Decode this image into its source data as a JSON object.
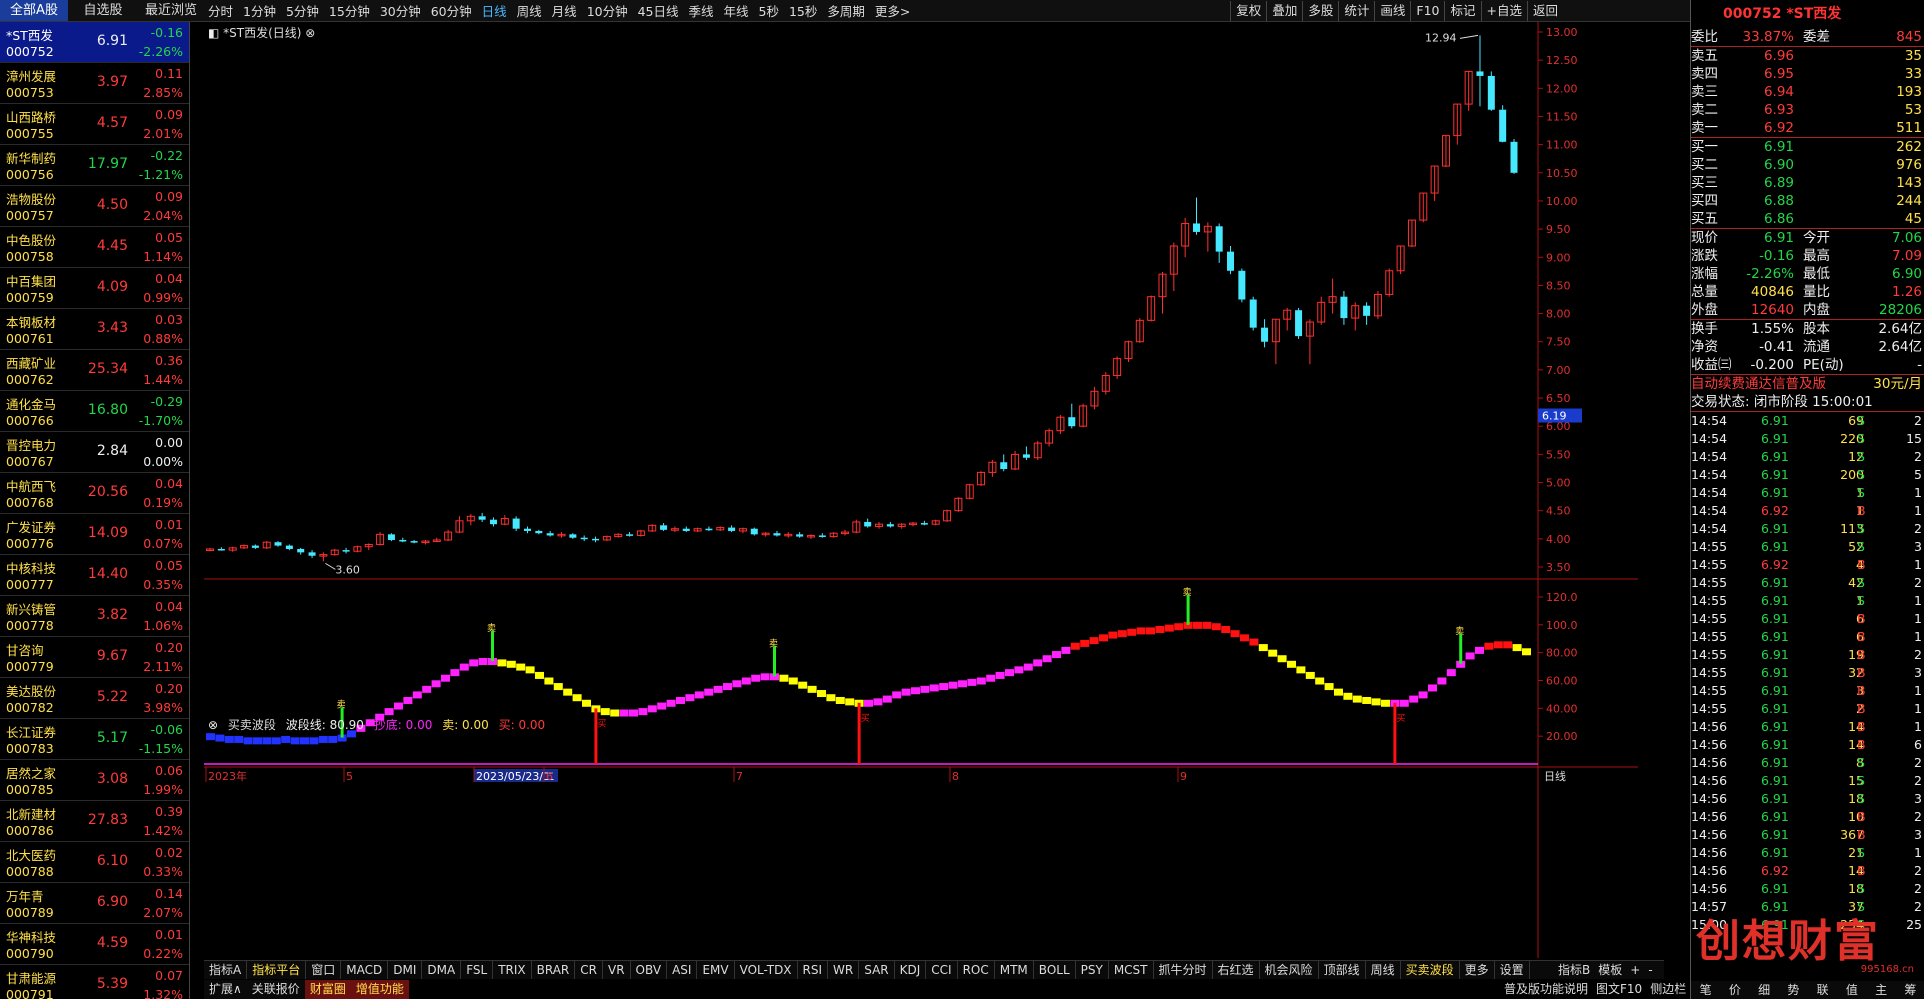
{
  "top": {
    "cats": [
      {
        "label": "全部A股",
        "x": 0,
        "w": 68,
        "active": true
      },
      {
        "label": "自选股",
        "x": 70,
        "w": 66,
        "active": false
      },
      {
        "label": "最近浏览",
        "x": 138,
        "w": 66,
        "active": false
      }
    ],
    "periods": [
      "分时",
      "1分钟",
      "5分钟",
      "15分钟",
      "30分钟",
      "60分钟",
      "日线",
      "周线",
      "月线",
      "10分钟",
      "45日线",
      "季线",
      "年线",
      "5秒",
      "15秒",
      "多周期",
      "更多>"
    ],
    "period_selected": "日线",
    "tools": [
      "复权",
      "叠加",
      "多股",
      "统计",
      "画线",
      "F10",
      "标记",
      "+自选",
      "返回"
    ]
  },
  "stocks": [
    {
      "name": "*ST西发",
      "code": "000752",
      "price": "6.91",
      "chg": "-0.16",
      "pct": "-2.26%",
      "dir": "d",
      "pc": "wht",
      "sel": true
    },
    {
      "name": "漳州发展",
      "code": "000753",
      "price": "3.97",
      "chg": "0.11",
      "pct": "2.85%",
      "dir": "u"
    },
    {
      "name": "山西路桥",
      "code": "000755",
      "price": "4.57",
      "chg": "0.09",
      "pct": "2.01%",
      "dir": "u"
    },
    {
      "name": "新华制药",
      "code": "000756",
      "price": "17.97",
      "chg": "-0.22",
      "pct": "-1.21%",
      "dir": "d"
    },
    {
      "name": "浩物股份",
      "code": "000757",
      "price": "4.50",
      "chg": "0.09",
      "pct": "2.04%",
      "dir": "u"
    },
    {
      "name": "中色股份",
      "code": "000758",
      "price": "4.45",
      "chg": "0.05",
      "pct": "1.14%",
      "dir": "u"
    },
    {
      "name": "中百集团",
      "code": "000759",
      "price": "4.09",
      "chg": "0.04",
      "pct": "0.99%",
      "dir": "u"
    },
    {
      "name": "本钢板材",
      "code": "000761",
      "price": "3.43",
      "chg": "0.03",
      "pct": "0.88%",
      "dir": "u"
    },
    {
      "name": "西藏矿业",
      "code": "000762",
      "price": "25.34",
      "chg": "0.36",
      "pct": "1.44%",
      "dir": "u"
    },
    {
      "name": "通化金马",
      "code": "000766",
      "price": "16.80",
      "chg": "-0.29",
      "pct": "-1.70%",
      "dir": "d"
    },
    {
      "name": "晋控电力",
      "code": "000767",
      "price": "2.84",
      "chg": "0.00",
      "pct": "0.00%",
      "dir": "n"
    },
    {
      "name": "中航西飞",
      "code": "000768",
      "price": "20.56",
      "chg": "0.04",
      "pct": "0.19%",
      "dir": "u"
    },
    {
      "name": "广发证券",
      "code": "000776",
      "price": "14.09",
      "chg": "0.01",
      "pct": "0.07%",
      "dir": "u"
    },
    {
      "name": "中核科技",
      "code": "000777",
      "price": "14.40",
      "chg": "0.05",
      "pct": "0.35%",
      "dir": "u"
    },
    {
      "name": "新兴铸管",
      "code": "000778",
      "price": "3.82",
      "chg": "0.04",
      "pct": "1.06%",
      "dir": "u"
    },
    {
      "name": "甘咨询",
      "code": "000779",
      "price": "9.67",
      "chg": "0.20",
      "pct": "2.11%",
      "dir": "u"
    },
    {
      "name": "美达股份",
      "code": "000782",
      "price": "5.22",
      "chg": "0.20",
      "pct": "3.98%",
      "dir": "u"
    },
    {
      "name": "长江证券",
      "code": "000783",
      "price": "5.17",
      "chg": "-0.06",
      "pct": "-1.15%",
      "dir": "d"
    },
    {
      "name": "居然之家",
      "code": "000785",
      "price": "3.08",
      "chg": "0.06",
      "pct": "1.99%",
      "dir": "u"
    },
    {
      "name": "北新建材",
      "code": "000786",
      "price": "27.83",
      "chg": "0.39",
      "pct": "1.42%",
      "dir": "u"
    },
    {
      "name": "北大医药",
      "code": "000788",
      "price": "6.10",
      "chg": "0.02",
      "pct": "0.33%",
      "dir": "u"
    },
    {
      "name": "万年青",
      "code": "000789",
      "price": "6.90",
      "chg": "0.14",
      "pct": "2.07%",
      "dir": "u"
    },
    {
      "name": "华神科技",
      "code": "000790",
      "price": "4.59",
      "chg": "0.01",
      "pct": "0.22%",
      "dir": "u"
    },
    {
      "name": "甘肃能源",
      "code": "000791",
      "price": "5.39",
      "chg": "0.07",
      "pct": "1.32%",
      "dir": "u"
    }
  ],
  "chart": {
    "title": "*ST西发(日线)",
    "high_label": "12.94",
    "low_label": "3.60",
    "cur_price": "6.19",
    "yticks": [
      "13.00",
      "12.50",
      "12.00",
      "11.50",
      "11.00",
      "10.50",
      "10.00",
      "9.50",
      "9.00",
      "8.50",
      "8.00",
      "7.50",
      "7.00",
      "6.50",
      "6.00",
      "5.50",
      "5.00",
      "4.50",
      "4.00",
      "3.50"
    ],
    "iyticks": [
      "120.0",
      "100.0",
      "80.00",
      "60.00",
      "40.00",
      "20.00"
    ],
    "xlabels": [
      "2023年",
      "5",
      "2023/05/23/二",
      "6",
      "7",
      "8",
      "9"
    ],
    "period": "日线",
    "indicator": {
      "name": "买卖波段",
      "line_label": "波段线: 80.90",
      "bottom_label": "抄底: 0.00",
      "sell_label": "卖: 0.00",
      "buy_label": "买: 0.00"
    },
    "marker_sell": "卖",
    "marker_buy": "买"
  },
  "itabs": [
    "指标A",
    "指标平台",
    "窗口",
    "MACD",
    "DMI",
    "DMA",
    "FSL",
    "TRIX",
    "BRAR",
    "CR",
    "VR",
    "OBV",
    "ASI",
    "EMV",
    "VOL-TDX",
    "RSI",
    "WR",
    "SAR",
    "KDJ",
    "CCI",
    "ROC",
    "MTM",
    "BOLL",
    "PSY",
    "MCST",
    "抓牛分时",
    "右红选",
    "机会风险",
    "顶部线",
    "周线",
    "买卖波段",
    "更多",
    "设置"
  ],
  "itab_sel": [
    "指标平台",
    "买卖波段"
  ],
  "itabs_extra": [
    "指标B",
    "模板",
    "+",
    "-"
  ],
  "itabs2": [
    {
      "t": "扩展∧",
      "hl": false
    },
    {
      "t": "关联报价",
      "hl": false
    },
    {
      "t": "财富圈",
      "hl": true
    },
    {
      "t": "增值功能",
      "hl": true
    }
  ],
  "bottom_right": [
    "普及版功能说明",
    "图文F10",
    "侧边栏"
  ],
  "right": {
    "header": "000752 *ST西发",
    "weibi": {
      "l": "委比",
      "v": "33.87%",
      "l2": "委差",
      "v2": "845"
    },
    "sells": [
      {
        "l": "卖五",
        "p": "6.96",
        "v": "35"
      },
      {
        "l": "卖四",
        "p": "6.95",
        "v": "33"
      },
      {
        "l": "卖三",
        "p": "6.94",
        "v": "193"
      },
      {
        "l": "卖二",
        "p": "6.93",
        "v": "53"
      },
      {
        "l": "卖一",
        "p": "6.92",
        "v": "511"
      }
    ],
    "buys": [
      {
        "l": "买一",
        "p": "6.91",
        "v": "262"
      },
      {
        "l": "买二",
        "p": "6.90",
        "v": "976"
      },
      {
        "l": "买三",
        "p": "6.89",
        "v": "143"
      },
      {
        "l": "买四",
        "p": "6.88",
        "v": "244"
      },
      {
        "l": "买五",
        "p": "6.86",
        "v": "45"
      }
    ],
    "stats": [
      {
        "l": "现价",
        "v": "6.91",
        "vc": "grn",
        "l2": "今开",
        "v2": "7.06",
        "v2c": "grn"
      },
      {
        "l": "涨跌",
        "v": "-0.16",
        "vc": "grn",
        "l2": "最高",
        "v2": "7.09",
        "v2c": "red"
      },
      {
        "l": "涨幅",
        "v": "-2.26%",
        "vc": "grn",
        "l2": "最低",
        "v2": "6.90",
        "v2c": "grn"
      },
      {
        "l": "总量",
        "v": "40846",
        "vc": "yel",
        "l2": "量比",
        "v2": "1.26",
        "v2c": "red"
      },
      {
        "l": "外盘",
        "v": "12640",
        "vc": "red",
        "l2": "内盘",
        "v2": "28206",
        "v2c": "grn"
      }
    ],
    "stats2": [
      {
        "l": "换手",
        "v": "1.55%",
        "vc": "wht",
        "l2": "股本",
        "v2": "2.64亿",
        "v2c": "wht"
      },
      {
        "l": "净资",
        "v": "-0.41",
        "vc": "wht",
        "l2": "流通",
        "v2": "2.64亿",
        "v2c": "wht"
      },
      {
        "l": "收益㈢",
        "v": "-0.200",
        "vc": "wht",
        "l2": "PE(动)",
        "v2": "-",
        "v2c": "wht"
      }
    ],
    "promo": "自动续费通达信普及版",
    "promo_price": "30元/月",
    "trade_status": "交易状态: 闭市阶段 15:00:01",
    "ticks": [
      [
        "14:54",
        "6.91",
        "69",
        "S",
        "2"
      ],
      [
        "14:54",
        "6.91",
        "220",
        "S",
        "15"
      ],
      [
        "14:54",
        "6.91",
        "12",
        "S",
        "2"
      ],
      [
        "14:54",
        "6.91",
        "200",
        "S",
        "5"
      ],
      [
        "14:54",
        "6.91",
        "1",
        "S",
        "1"
      ],
      [
        "14:54",
        "6.92",
        "1",
        "B",
        "1"
      ],
      [
        "14:54",
        "6.91",
        "113",
        "S",
        "2"
      ],
      [
        "14:55",
        "6.91",
        "52",
        "S",
        "3"
      ],
      [
        "14:55",
        "6.92",
        "4",
        "B",
        "1"
      ],
      [
        "14:55",
        "6.91",
        "42",
        "S",
        "2"
      ],
      [
        "14:55",
        "6.91",
        "1",
        "S",
        "1"
      ],
      [
        "14:55",
        "6.91",
        "6",
        "B",
        "1"
      ],
      [
        "14:55",
        "6.91",
        "6",
        "B",
        "1"
      ],
      [
        "14:55",
        "6.91",
        "19",
        "B",
        "2"
      ],
      [
        "14:55",
        "6.91",
        "32",
        "B",
        "3"
      ],
      [
        "14:55",
        "6.91",
        "3",
        "B",
        "1"
      ],
      [
        "14:55",
        "6.91",
        "2",
        "B",
        "1"
      ],
      [
        "14:56",
        "6.91",
        "14",
        "B",
        "1"
      ],
      [
        "14:56",
        "6.91",
        "14",
        "B",
        "6"
      ],
      [
        "14:56",
        "6.91",
        "8",
        "S",
        "2"
      ],
      [
        "14:56",
        "6.91",
        "15",
        "S",
        "2"
      ],
      [
        "14:56",
        "6.91",
        "18",
        "S",
        "3"
      ],
      [
        "14:56",
        "6.91",
        "10",
        "B",
        "2"
      ],
      [
        "14:56",
        "6.91",
        "367",
        "B",
        "3"
      ],
      [
        "14:56",
        "6.91",
        "21",
        "S",
        "1"
      ],
      [
        "14:56",
        "6.92",
        "14",
        "B",
        "2"
      ],
      [
        "14:56",
        "6.91",
        "18",
        "S",
        "2"
      ],
      [
        "14:57",
        "6.91",
        "37",
        "S",
        "2"
      ],
      [
        "15:00",
        "6.91",
        "254",
        "S",
        "25"
      ]
    ],
    "bottabs": [
      "笔",
      "价",
      "细",
      "势",
      "联",
      "值",
      "主",
      "筹"
    ],
    "watermark": "创想财富",
    "watermark_site": "995168.cn"
  }
}
